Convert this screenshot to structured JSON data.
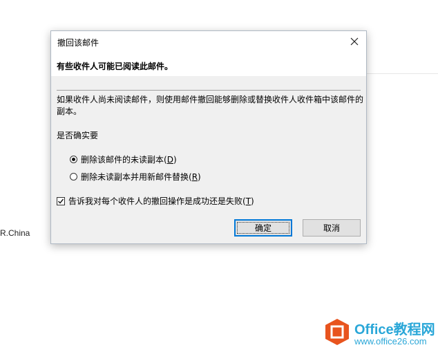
{
  "background": {
    "partial_text": "R.China"
  },
  "dialog": {
    "title": "撤回该邮件",
    "heading": "有些收件人可能已阅读此邮件。",
    "description": "如果收件人尚未阅读邮件，则使用邮件撤回能够删除或替换收件人收件箱中该邮件的副本。",
    "question": "是否确实要",
    "options": [
      {
        "label": "删除该邮件的未读副本(",
        "mnemonic": "D",
        "suffix": ")",
        "selected": true
      },
      {
        "label": "删除未读副本并用新邮件替换(",
        "mnemonic": "R",
        "suffix": ")",
        "selected": false
      }
    ],
    "notify": {
      "label": "告诉我对每个收件人的撤回操作是成功还是失败(",
      "mnemonic": "T",
      "suffix": ")",
      "checked": true
    },
    "ok_label": "确定",
    "cancel_label": "取消"
  },
  "watermark": {
    "brand": "Office教程网",
    "url": "www.office26.com",
    "color": "#2aa7d8",
    "logo_color": "#e8541e"
  }
}
